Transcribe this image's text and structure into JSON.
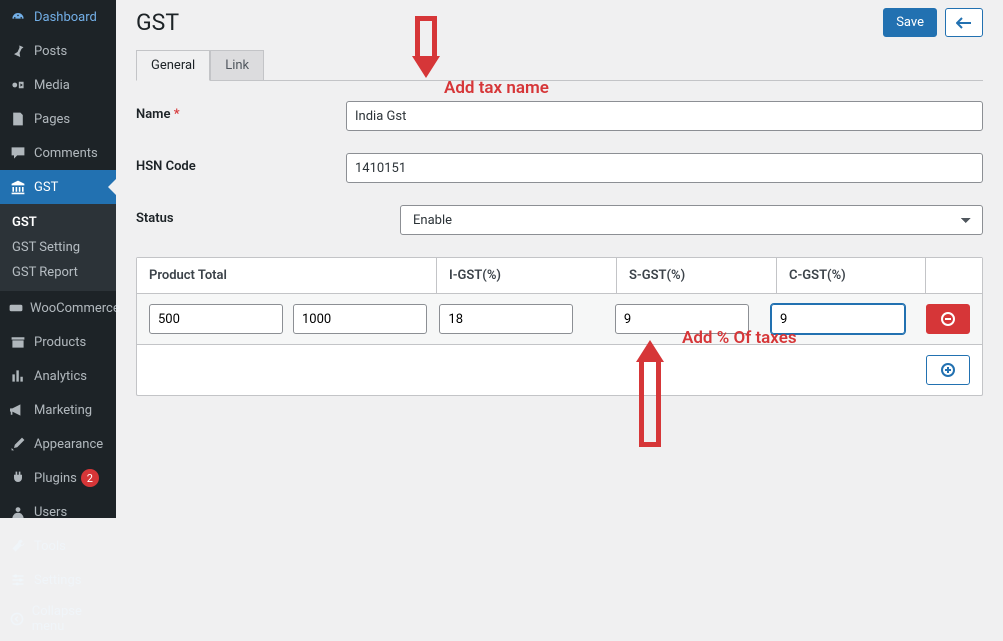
{
  "sidebar": {
    "items": [
      {
        "label": "Dashboard",
        "icon": "dashboard"
      },
      {
        "label": "Posts",
        "icon": "pin"
      },
      {
        "label": "Media",
        "icon": "media"
      },
      {
        "label": "Pages",
        "icon": "page"
      },
      {
        "label": "Comments",
        "icon": "comment"
      },
      {
        "label": "GST",
        "icon": "bank"
      },
      {
        "label": "WooCommerce",
        "icon": "woo"
      },
      {
        "label": "Products",
        "icon": "products"
      },
      {
        "label": "Analytics",
        "icon": "analytics"
      },
      {
        "label": "Marketing",
        "icon": "megaphone"
      },
      {
        "label": "Appearance",
        "icon": "appearance"
      },
      {
        "label": "Plugins",
        "icon": "plugins",
        "badge": "2"
      },
      {
        "label": "Users",
        "icon": "users"
      },
      {
        "label": "Tools",
        "icon": "tools"
      },
      {
        "label": "Settings",
        "icon": "settings"
      },
      {
        "label": "Collapse menu",
        "icon": "collapse"
      }
    ],
    "sub": [
      {
        "label": "GST"
      },
      {
        "label": "GST Setting"
      },
      {
        "label": "GST Report"
      }
    ]
  },
  "header": {
    "title": "GST",
    "save": "Save"
  },
  "tabs": [
    {
      "label": "General"
    },
    {
      "label": "Link"
    }
  ],
  "form": {
    "name_label": "Name",
    "name_value": "India Gst",
    "hsn_label": "HSN Code",
    "hsn_value": "1410151",
    "status_label": "Status",
    "status_value": "Enable"
  },
  "grid": {
    "headers": {
      "ptotal": "Product Total",
      "igst": "I-GST(%)",
      "sgst": "S-GST(%)",
      "cgst": "C-GST(%)"
    },
    "row": {
      "from": "500",
      "to": "1000",
      "igst": "18",
      "sgst": "9",
      "cgst": "9"
    }
  },
  "annotations": {
    "top": "Add tax name",
    "bottom": "Add % Of taxes"
  }
}
